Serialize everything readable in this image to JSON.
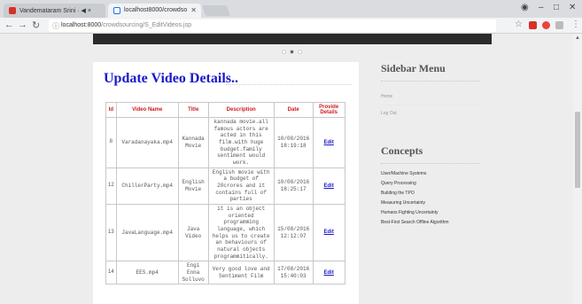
{
  "browser": {
    "tabs": [
      {
        "title": "Vandemataram Srini · ◀ ×",
        "active": false,
        "color": "#d93025"
      },
      {
        "title": "localhost8000/crowdso",
        "active": true,
        "color": "#1a73e8"
      }
    ],
    "address": {
      "host": "localhost:8000",
      "path": "/crowdsourcing/S_EditVideos.jsp"
    },
    "icons": [
      "info-icon",
      "star-icon",
      "kebab-icon"
    ]
  },
  "page": {
    "title": "Update Video Details..",
    "columns": [
      "Id",
      "Video Name",
      "Title",
      "Description",
      "Date",
      "Provide Details"
    ],
    "rows": [
      {
        "id": "8",
        "video_name": "Varadanayaka.mp4",
        "title": "Kannada Movie",
        "description": "kannada movie.all famous actors are acted in this film.with huge budget.family sentiment would work.",
        "date": "10/08/2016 18:19:18",
        "action": "Edit"
      },
      {
        "id": "12",
        "video_name": "ChillerParty.mp4",
        "title": "English Movie",
        "description": "English movie with a budget of 20crores and it contains full of parties",
        "date": "10/08/2016 18:25:17",
        "action": "Edit"
      },
      {
        "id": "13",
        "video_name": "JavaLanguage.mp4",
        "title": "Java Video",
        "description": "it is an object oriented programming language, which helps us to create an behaviours of natural objects programmitically.",
        "date": "15/08/2016 12:12:07",
        "action": "Edit"
      },
      {
        "id": "14",
        "video_name": "EES.mp4",
        "title": "Engi Enna Solluvo",
        "description": "Very good love and Sentiment Film",
        "date": "17/08/2016 15:40:03",
        "action": "Edit"
      }
    ]
  },
  "sidebar": {
    "menu_heading": "Sidebar Menu",
    "menu_links": [
      "Home",
      "Log Out"
    ],
    "concepts_heading": "Concepts",
    "concepts": [
      "User/Machine Systems",
      "Query Processing",
      "Building the TPO",
      "Measuring Uncertainty",
      "Humans Fighting Uncertainty",
      "Best-First Search Offline Algorithm"
    ]
  },
  "colors": {
    "title_blue": "#1a1ac8",
    "header_red": "#d01a1a"
  }
}
